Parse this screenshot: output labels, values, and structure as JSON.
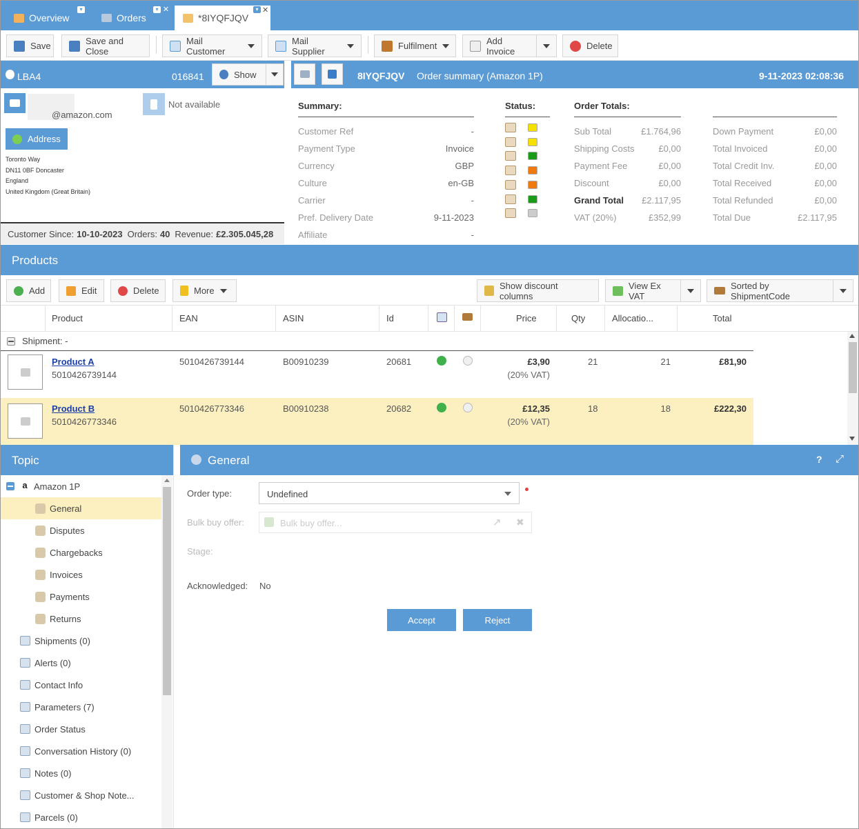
{
  "tabs": [
    {
      "label": "Overview"
    },
    {
      "label": "Orders"
    },
    {
      "label": "*8IYQFJQV"
    }
  ],
  "toolbar": {
    "save": "Save",
    "save_close": "Save and Close",
    "mail_customer": "Mail Customer",
    "mail_supplier": "Mail Supplier",
    "fulfilment": "Fulfilment",
    "add_invoice": "Add Invoice",
    "delete": "Delete"
  },
  "customer": {
    "name": "LBA4",
    "number": "016841",
    "show": "Show",
    "email": "@amazon.com",
    "phone": "Not available",
    "address_btn": "Address",
    "address_lines": [
      "Toronto Way",
      "DN11 0BF Doncaster",
      "England",
      "United Kingdom (Great Britain)"
    ],
    "since_label": "Customer Since:",
    "since": "10-10-2023",
    "orders_label": "Orders:",
    "orders": "40",
    "revenue_label": "Revenue:",
    "revenue": "£2.305.045,28"
  },
  "order": {
    "code": "8IYQFJQV",
    "summary_title": "Order summary (Amazon 1P)",
    "datetime": "9-11-2023 02:08:36"
  },
  "summary": {
    "heading": "Summary:",
    "rows": [
      {
        "label": "Customer Ref",
        "value": "-"
      },
      {
        "label": "Payment Type",
        "value": "Invoice"
      },
      {
        "label": "Currency",
        "value": "GBP"
      },
      {
        "label": "Culture",
        "value": "en-GB"
      },
      {
        "label": "Carrier",
        "value": "-"
      },
      {
        "label": "Pref. Delivery Date",
        "value": "9-11-2023"
      },
      {
        "label": "Affiliate",
        "value": "-"
      }
    ]
  },
  "status": {
    "heading": "Status:",
    "items": [
      {
        "icon": "house-icon",
        "color": "#f5e000"
      },
      {
        "icon": "money-icon",
        "color": "#f5e000"
      },
      {
        "icon": "chart-icon",
        "color": "#1a9c1a"
      },
      {
        "icon": "box-icon",
        "color": "#f07a10"
      },
      {
        "icon": "truck-icon",
        "color": "#f07a10"
      },
      {
        "icon": "tag-icon",
        "color": "#1a9c1a"
      },
      {
        "icon": "invoice-icon",
        "color": "#cccccc"
      }
    ]
  },
  "totals": {
    "heading": "Order Totals:",
    "left": [
      {
        "label": "Sub Total",
        "value": "£1.764,96",
        "bold": false
      },
      {
        "label": "Shipping Costs",
        "value": "£0,00",
        "bold": false
      },
      {
        "label": "Payment Fee",
        "value": "£0,00",
        "bold": false
      },
      {
        "label": "Discount",
        "value": "£0,00",
        "bold": false
      },
      {
        "label": "Grand Total",
        "value": "£2.117,95",
        "bold": true
      },
      {
        "label": "VAT (20%)",
        "value": "£352,99",
        "bold": false
      }
    ],
    "right": [
      {
        "label": "Down Payment",
        "value": "£0,00"
      },
      {
        "label": "Total Invoiced",
        "value": "£0,00"
      },
      {
        "label": "Total Credit Inv.",
        "value": "£0,00"
      },
      {
        "label": "Total Received",
        "value": "£0,00"
      },
      {
        "label": "Total Refunded",
        "value": "£0,00"
      },
      {
        "label": "Total Due",
        "value": "£2.117,95"
      }
    ]
  },
  "products": {
    "title": "Products",
    "toolbar": {
      "add": "Add",
      "edit": "Edit",
      "delete": "Delete",
      "more": "More",
      "discount": "Show discount columns",
      "vat": "View Ex VAT",
      "sort": "Sorted by ShipmentCode"
    },
    "columns": [
      "Product",
      "EAN",
      "ASIN",
      "Id",
      "",
      "",
      "Price",
      "Qty",
      "Allocatio...",
      "Total"
    ],
    "shipment_label": "Shipment: -",
    "rows": [
      {
        "name": "Product A",
        "code": "5010426739144",
        "ean": "5010426739144",
        "asin": "B00910239",
        "id": "20681",
        "price": "£3,90",
        "vat": "(20% VAT)",
        "qty": "21",
        "alloc": "21",
        "total": "£81,90"
      },
      {
        "name": "Product B",
        "code": "5010426773346",
        "ean": "5010426773346",
        "asin": "B00910238",
        "id": "20682",
        "price": "£12,35",
        "vat": "(20% VAT)",
        "qty": "18",
        "alloc": "18",
        "total": "£222,30"
      }
    ]
  },
  "topic": {
    "title": "Topic",
    "root": "Amazon 1P",
    "children": [
      {
        "label": "General",
        "icon": "gear-icon"
      },
      {
        "label": "Disputes",
        "icon": "person-icon"
      },
      {
        "label": "Chargebacks",
        "icon": "money-icon"
      },
      {
        "label": "Invoices",
        "icon": "invoice-icon"
      },
      {
        "label": "Payments",
        "icon": "money-icon"
      },
      {
        "label": "Returns",
        "icon": "return-icon"
      }
    ],
    "items": [
      {
        "label": "Shipments (0)",
        "icon": "truck-icon"
      },
      {
        "label": "Alerts (0)",
        "icon": "alert-icon"
      },
      {
        "label": "Contact Info",
        "icon": "contact-icon"
      },
      {
        "label": "Parameters (7)",
        "icon": "list-icon"
      },
      {
        "label": "Order Status",
        "icon": "grid-icon"
      },
      {
        "label": "Conversation History (0)",
        "icon": "mail-icon"
      },
      {
        "label": "Notes (0)",
        "icon": "note-icon"
      },
      {
        "label": "Customer & Shop Note...",
        "icon": "note-icon"
      },
      {
        "label": "Parcels (0)",
        "icon": "parcel-icon"
      }
    ]
  },
  "general": {
    "title": "General",
    "order_type_label": "Order type:",
    "order_type_value": "Undefined",
    "bulk_label": "Bulk buy offer:",
    "bulk_placeholder": "Bulk buy offer...",
    "stage_label": "Stage:",
    "ack_label": "Acknowledged:",
    "ack_value": "No",
    "accept": "Accept",
    "reject": "Reject"
  }
}
